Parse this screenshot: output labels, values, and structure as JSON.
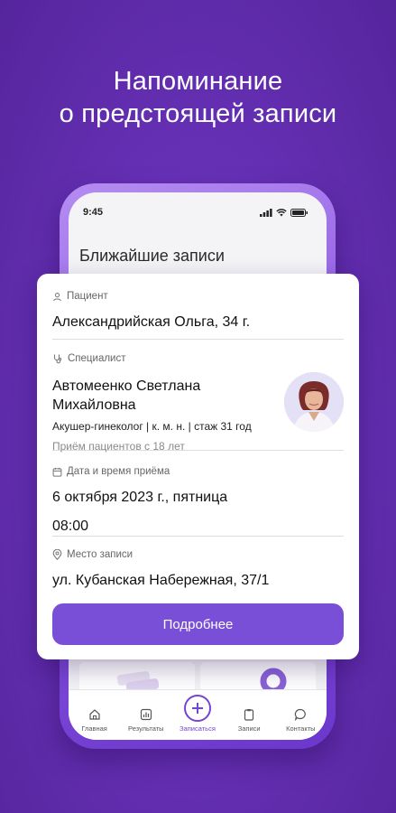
{
  "headline": {
    "line1": "Напоминание",
    "line2": "о предстоящей записи"
  },
  "phone": {
    "status_time": "9:45",
    "screen_title": "Ближайшие записи",
    "tabs": [
      {
        "label": "Главная",
        "icon": "home-icon"
      },
      {
        "label": "Результаты",
        "icon": "chart-icon"
      },
      {
        "label": "Записаться",
        "icon": "plus-circle-icon"
      },
      {
        "label": "Записи",
        "icon": "clipboard-icon"
      },
      {
        "label": "Контакты",
        "icon": "chat-icon"
      }
    ],
    "active_tab": "Записаться"
  },
  "appointment": {
    "patient_label": "Пациент",
    "patient_value": "Александрийская Ольга, 34 г.",
    "specialist_label": "Специалист",
    "specialist_name": "Автомеенко Светлана Михайловна",
    "specialist_details": "Акушер-гинеколог | к. м. н. | стаж 31 год",
    "specialist_age": "Приём пациентов с 18 лет",
    "date_label": "Дата и время приёма",
    "date_value": "6 октября 2023 г., пятница",
    "time_value": "08:00",
    "place_label": "Место записи",
    "place_value": "ул. Кубанская Набережная, 37/1",
    "button_label": "Подробнее"
  },
  "colors": {
    "background": "#6630b5",
    "accent": "#7a4fd8",
    "card": "#ffffff"
  }
}
